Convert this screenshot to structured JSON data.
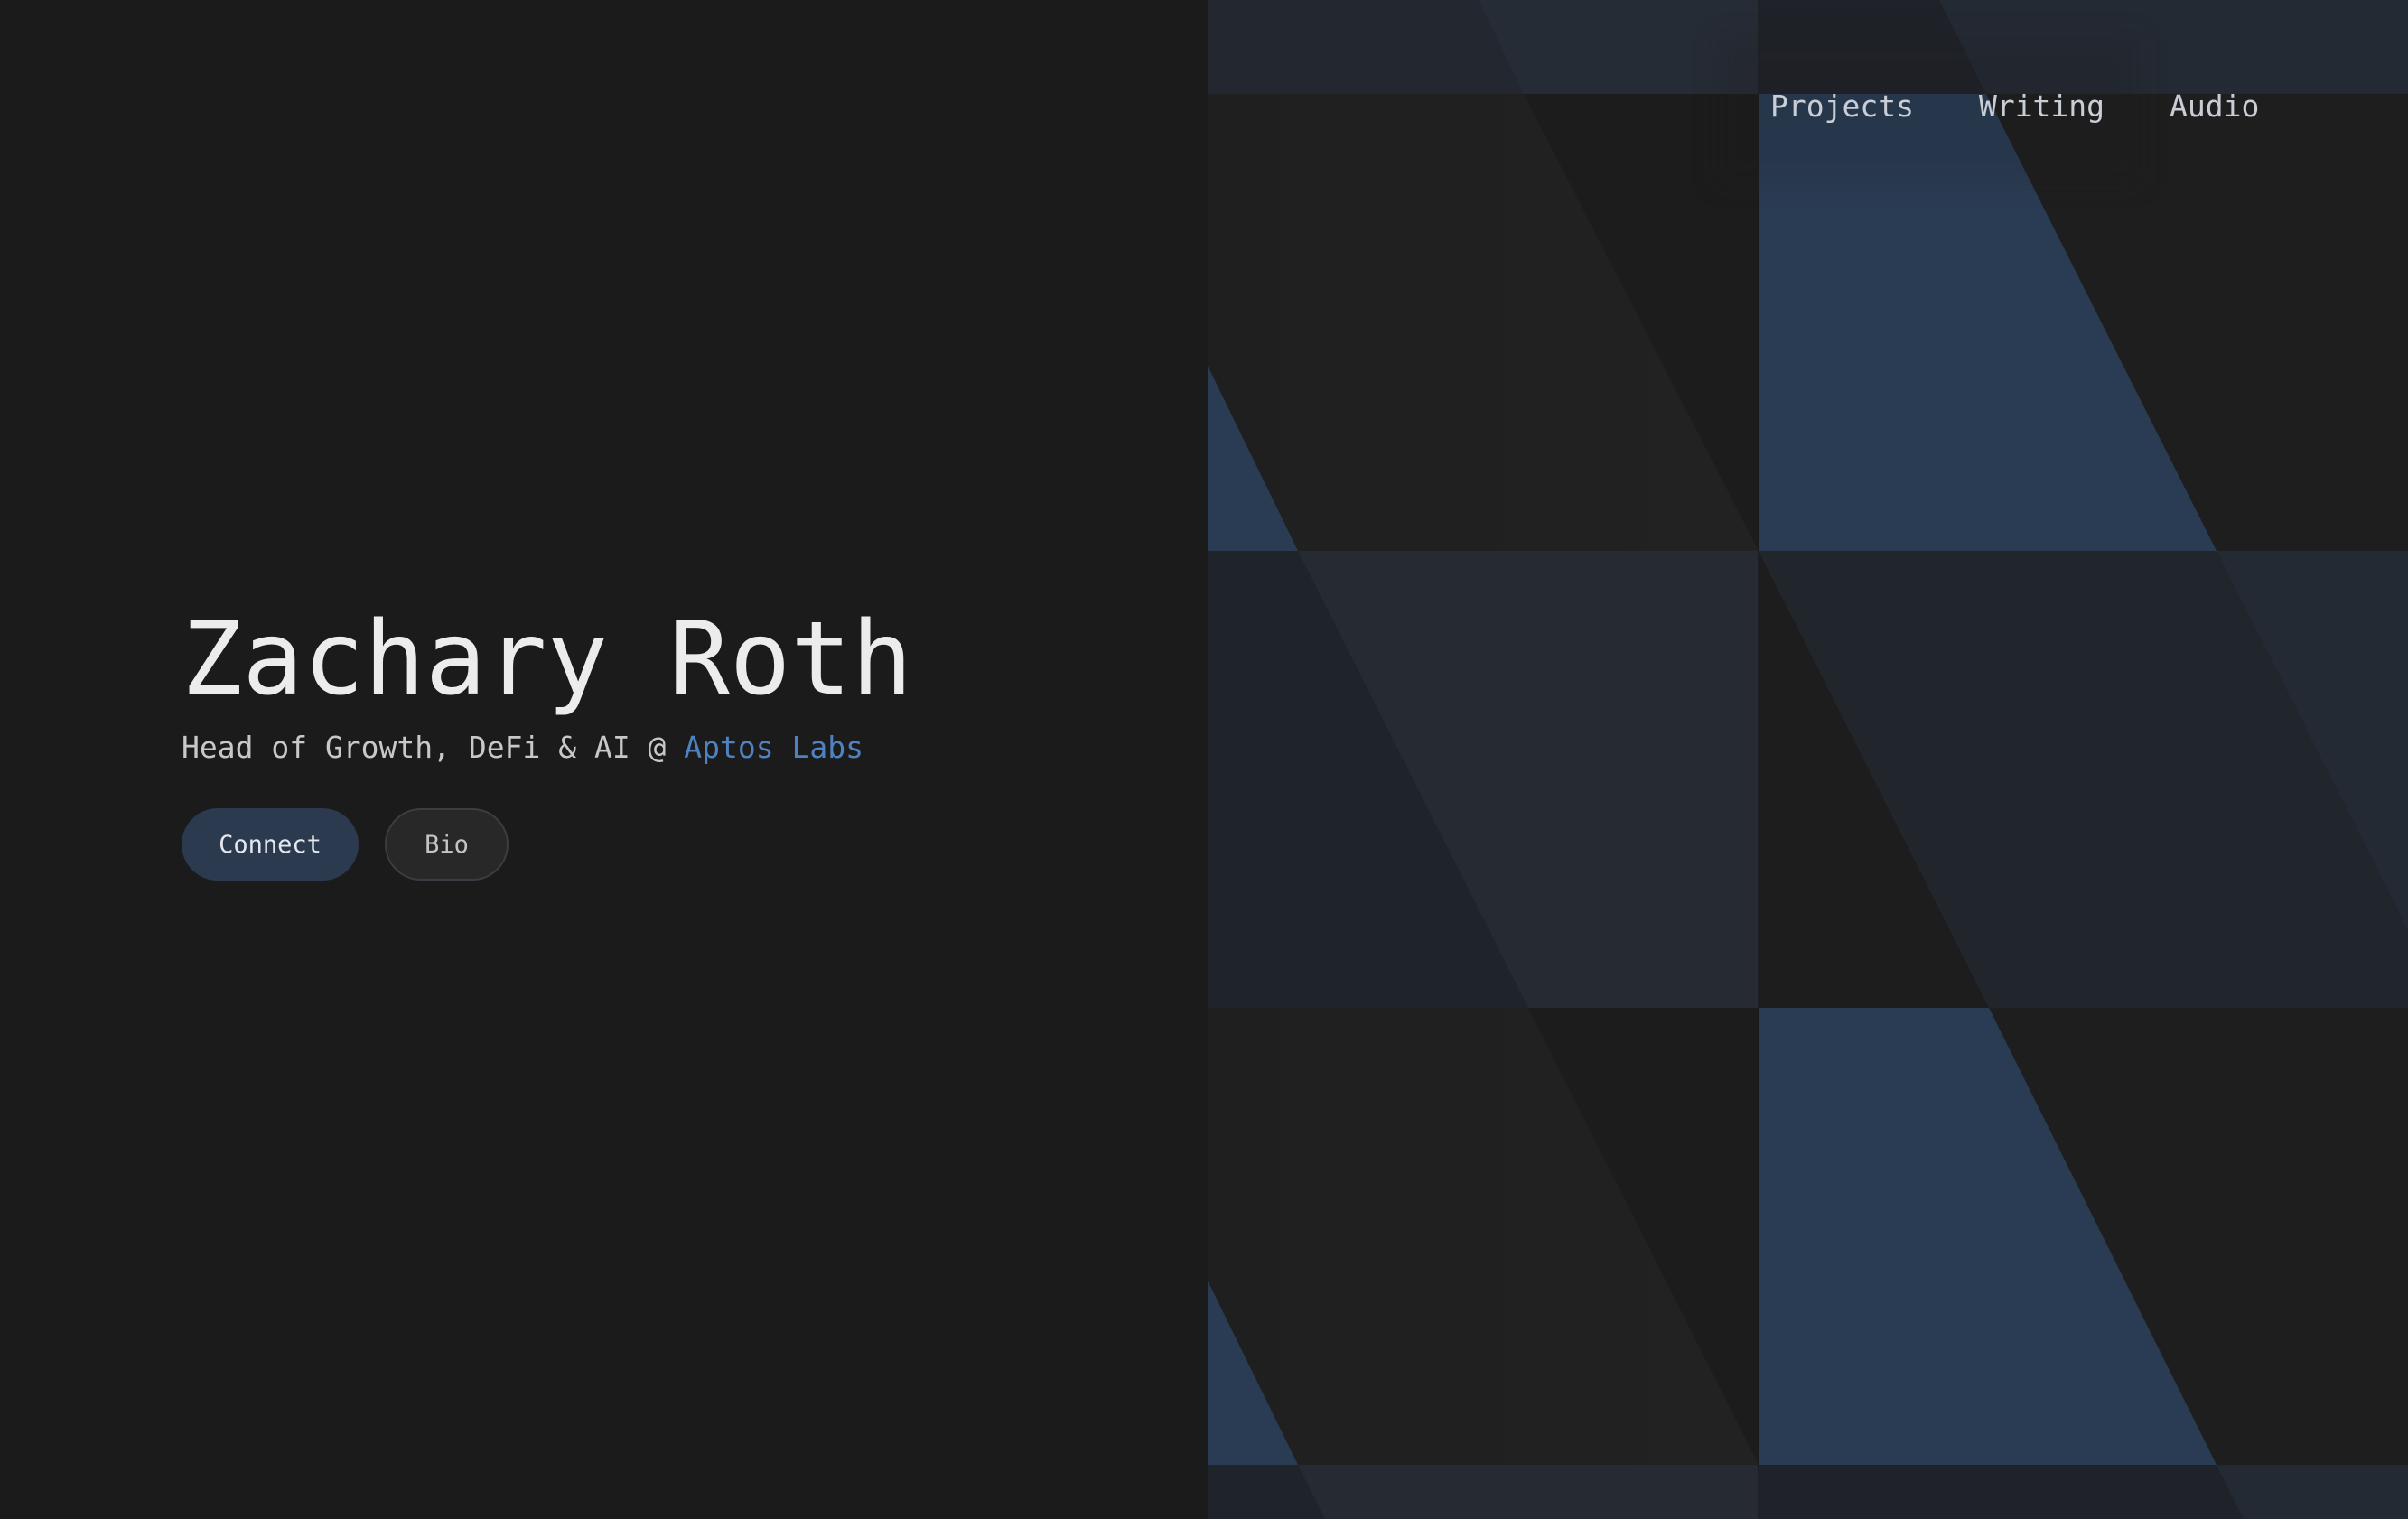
{
  "hero": {
    "name": "Zachary Roth",
    "tagline_prefix": "Head of Growth, DeFi & AI @ ",
    "company": "Aptos Labs"
  },
  "buttons": {
    "connect": "Connect",
    "bio": "Bio"
  },
  "nav": {
    "projects": "Projects",
    "writing": "Writing",
    "audio": "Audio"
  },
  "colors": {
    "background": "#1b1b1b",
    "accent": "#4f82bf",
    "button_primary": "#2b3a4e",
    "pattern_blue": "#2a3c54"
  }
}
